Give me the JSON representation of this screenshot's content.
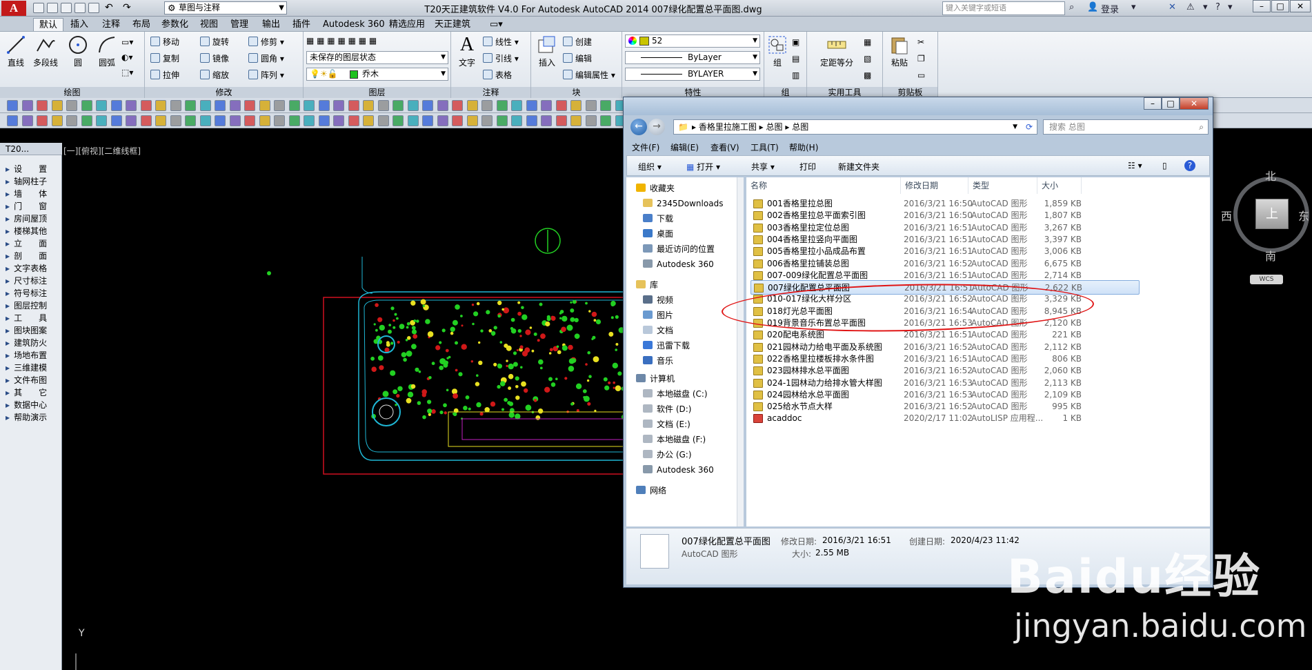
{
  "title_bar": {
    "app_logo": "A",
    "workspace": "草图与注释",
    "window_title": "T20天正建筑软件 V4.0 For Autodesk AutoCAD 2014    007绿化配置总平面图.dwg",
    "search_placeholder": "键入关键字或短语",
    "login": "登录",
    "help": "?"
  },
  "ribbon_tabs": [
    "默认",
    "插入",
    "注释",
    "布局",
    "参数化",
    "视图",
    "管理",
    "输出",
    "插件",
    "Autodesk 360",
    "精选应用",
    "天正建筑"
  ],
  "ribbon": {
    "draw": {
      "line": "直线",
      "polyline": "多段线",
      "circle": "圆",
      "arc": "圆弧",
      "label": "绘图"
    },
    "modify": {
      "move": "移动",
      "rotate": "旋转",
      "trim": "修剪",
      "copy": "复制",
      "mirror": "镜像",
      "fillet": "圆角",
      "stretch": "拉伸",
      "scale": "缩放",
      "array": "阵列",
      "label": "修改"
    },
    "layers": {
      "layer_state": "未保存的图层状态",
      "current_layer": "乔木",
      "label": "图层"
    },
    "annotation": {
      "text": "文字",
      "linear": "线性",
      "leader": "引线",
      "table": "表格",
      "label": "注释"
    },
    "block": {
      "insert": "插入",
      "create": "创建",
      "edit": "编辑",
      "edit_attr": "编辑属性",
      "label": "块"
    },
    "properties": {
      "color": "52",
      "linetype": "ByLayer",
      "lineweight": "BYLAYER",
      "label": "特性"
    },
    "groups": {
      "group": "组",
      "label": "组"
    },
    "utilities": {
      "measure": "定距等分",
      "label": "实用工具"
    },
    "clipboard": {
      "paste": "粘贴",
      "label": "剪贴板"
    }
  },
  "t20_panel": {
    "header": "T20...",
    "items": [
      "设　　置",
      "轴网柱子",
      "墙　　体",
      "门　　窗",
      "房间屋顶",
      "楼梯其他",
      "立　　面",
      "剖　　面",
      "文字表格",
      "尺寸标注",
      "符号标注",
      "图层控制",
      "工　　具",
      "图块图案",
      "建筑防火",
      "场地布置",
      "三维建模",
      "文件布图",
      "其　　它",
      "数据中心",
      "帮助演示"
    ]
  },
  "drawing": {
    "view_label": "[一][俯视][二维线框]",
    "ucs_label": "Y"
  },
  "viewcube": {
    "north": "北",
    "south": "南",
    "west": "西",
    "east": "东",
    "face": "上",
    "wcs": "WCS"
  },
  "explorer": {
    "breadcrumb": [
      "香格里拉施工图",
      "总图",
      "总图"
    ],
    "search_placeholder": "搜索 总图",
    "menu": [
      "文件(F)",
      "编辑(E)",
      "查看(V)",
      "工具(T)",
      "帮助(H)"
    ],
    "commands": [
      "组织 ▾",
      "打开 ▾",
      "共享 ▾",
      "打印",
      "新建文件夹"
    ],
    "nav": [
      {
        "label": "收藏夹",
        "icon": "star-icon",
        "kind": "header"
      },
      {
        "label": "2345Downloads",
        "icon": "folder-icon",
        "kind": "item"
      },
      {
        "label": "下载",
        "icon": "download-folder-icon",
        "kind": "item"
      },
      {
        "label": "桌面",
        "icon": "desktop-icon",
        "kind": "item"
      },
      {
        "label": "最近访问的位置",
        "icon": "recent-places-icon",
        "kind": "item"
      },
      {
        "label": "Autodesk 360",
        "icon": "cloud-icon",
        "kind": "item"
      },
      {
        "label": "库",
        "icon": "library-icon",
        "kind": "header"
      },
      {
        "label": "视频",
        "icon": "video-icon",
        "kind": "item"
      },
      {
        "label": "图片",
        "icon": "pictures-icon",
        "kind": "item"
      },
      {
        "label": "文档",
        "icon": "documents-icon",
        "kind": "item"
      },
      {
        "label": "迅雷下载",
        "icon": "thunder-icon",
        "kind": "item"
      },
      {
        "label": "音乐",
        "icon": "music-icon",
        "kind": "item"
      },
      {
        "label": "计算机",
        "icon": "computer-icon",
        "kind": "header"
      },
      {
        "label": "本地磁盘 (C:)",
        "icon": "drive-icon",
        "kind": "item"
      },
      {
        "label": "软件 (D:)",
        "icon": "drive-icon",
        "kind": "item"
      },
      {
        "label": "文档 (E:)",
        "icon": "drive-icon",
        "kind": "item"
      },
      {
        "label": "本地磁盘 (F:)",
        "icon": "drive-icon",
        "kind": "item"
      },
      {
        "label": "办公 (G:)",
        "icon": "drive-icon",
        "kind": "item"
      },
      {
        "label": "Autodesk 360",
        "icon": "cloud-icon",
        "kind": "item"
      },
      {
        "label": "网络",
        "icon": "network-icon",
        "kind": "header"
      }
    ],
    "columns": [
      "名称",
      "修改日期",
      "类型",
      "大小"
    ],
    "files": [
      {
        "name": "001香格里拉总图",
        "date": "2016/3/21 16:50",
        "type": "AutoCAD 图形",
        "size": "1,859 KB"
      },
      {
        "name": "002香格里拉总平面索引图",
        "date": "2016/3/21 16:50",
        "type": "AutoCAD 图形",
        "size": "1,807 KB"
      },
      {
        "name": "003香格里拉定位总图",
        "date": "2016/3/21 16:51",
        "type": "AutoCAD 图形",
        "size": "3,267 KB"
      },
      {
        "name": "004香格里拉竖向平面图",
        "date": "2016/3/21 16:51",
        "type": "AutoCAD 图形",
        "size": "3,397 KB"
      },
      {
        "name": "005香格里拉小品成品布置",
        "date": "2016/3/21 16:51",
        "type": "AutoCAD 图形",
        "size": "3,006 KB"
      },
      {
        "name": "006香格里拉铺装总图",
        "date": "2016/3/21 16:52",
        "type": "AutoCAD 图形",
        "size": "6,675 KB"
      },
      {
        "name": "007-009绿化配置总平面图",
        "date": "2016/3/21 16:51",
        "type": "AutoCAD 图形",
        "size": "2,714 KB"
      },
      {
        "name": "007绿化配置总平面图",
        "date": "2016/3/21 16:51",
        "type": "AutoCAD 图形",
        "size": "2,622 KB"
      },
      {
        "name": "010-017绿化大样分区",
        "date": "2016/3/21 16:52",
        "type": "AutoCAD 图形",
        "size": "3,329 KB"
      },
      {
        "name": "018灯光总平面图",
        "date": "2016/3/21 16:54",
        "type": "AutoCAD 图形",
        "size": "8,945 KB"
      },
      {
        "name": "019背景音乐布置总平面图",
        "date": "2016/3/21 16:53",
        "type": "AutoCAD 图形",
        "size": "2,120 KB"
      },
      {
        "name": "020配电系统图",
        "date": "2016/3/21 16:51",
        "type": "AutoCAD 图形",
        "size": "221 KB"
      },
      {
        "name": "021园林动力给电平面及系统图",
        "date": "2016/3/21 16:52",
        "type": "AutoCAD 图形",
        "size": "2,112 KB"
      },
      {
        "name": "022香格里拉楼板排水条件图",
        "date": "2016/3/21 16:51",
        "type": "AutoCAD 图形",
        "size": "806 KB"
      },
      {
        "name": "023园林排水总平面图",
        "date": "2016/3/21 16:52",
        "type": "AutoCAD 图形",
        "size": "2,060 KB"
      },
      {
        "name": "024-1园林动力给排水管大样图",
        "date": "2016/3/21 16:53",
        "type": "AutoCAD 图形",
        "size": "2,113 KB"
      },
      {
        "name": "024园林给水总平面图",
        "date": "2016/3/21 16:53",
        "type": "AutoCAD 图形",
        "size": "2,109 KB"
      },
      {
        "name": "025给水节点大样",
        "date": "2016/3/21 16:52",
        "type": "AutoCAD 图形",
        "size": "995 KB"
      },
      {
        "name": "acaddoc",
        "date": "2020/2/17 11:02",
        "type": "AutoLISP 应用程...",
        "size": "1 KB"
      }
    ],
    "selected_index": 7,
    "details": {
      "name": "007绿化配置总平面图",
      "type": "AutoCAD 图形",
      "modified_label": "修改日期:",
      "modified": "2016/3/21 16:51",
      "created_label": "创建日期:",
      "created": "2020/4/23 11:42",
      "size_label": "大小:",
      "size": "2.55 MB"
    }
  },
  "watermark": {
    "logo": "Baidu经验",
    "url": "jingyan.baidu.com"
  },
  "colors": {
    "selection": "#cfe2f8",
    "annotation_circle": "#e01414",
    "drawing_bg": "#000000"
  }
}
